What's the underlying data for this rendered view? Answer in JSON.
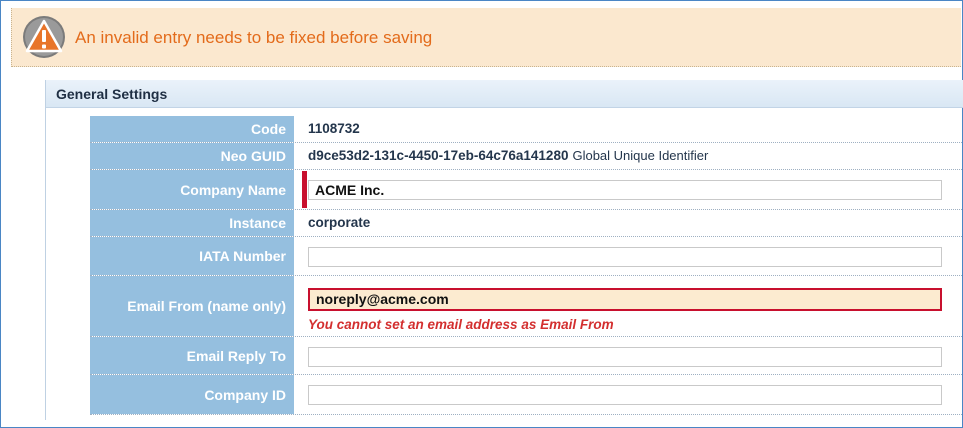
{
  "alert": {
    "icon": "warning-icon",
    "message": "An invalid entry needs to be fixed before saving",
    "colors": {
      "background": "#fbe8cf",
      "text": "#e36b1b",
      "icon": "#e8752a"
    }
  },
  "section": {
    "title": "General Settings"
  },
  "fields": {
    "code": {
      "label": "Code",
      "value": "1108732"
    },
    "neo_guid": {
      "label": "Neo GUID",
      "value": "d9ce53d2-131c-4450-17eb-64c76a141280",
      "note": "Global Unique Identifier"
    },
    "company_name": {
      "label": "Company Name",
      "value": "ACME Inc.",
      "required": true
    },
    "instance": {
      "label": "Instance",
      "value": "corporate"
    },
    "iata_number": {
      "label": "IATA Number",
      "value": ""
    },
    "email_from": {
      "label": "Email From (name only)",
      "value": "noreply@acme.com",
      "error": "You cannot set an email address as Email From"
    },
    "email_reply_to": {
      "label": "Email Reply To",
      "value": ""
    },
    "company_id": {
      "label": "Company ID",
      "value": ""
    }
  },
  "colors": {
    "label_bg": "#95bfdf",
    "error": "#c8102e",
    "invalid_bg": "#fcebd0"
  }
}
